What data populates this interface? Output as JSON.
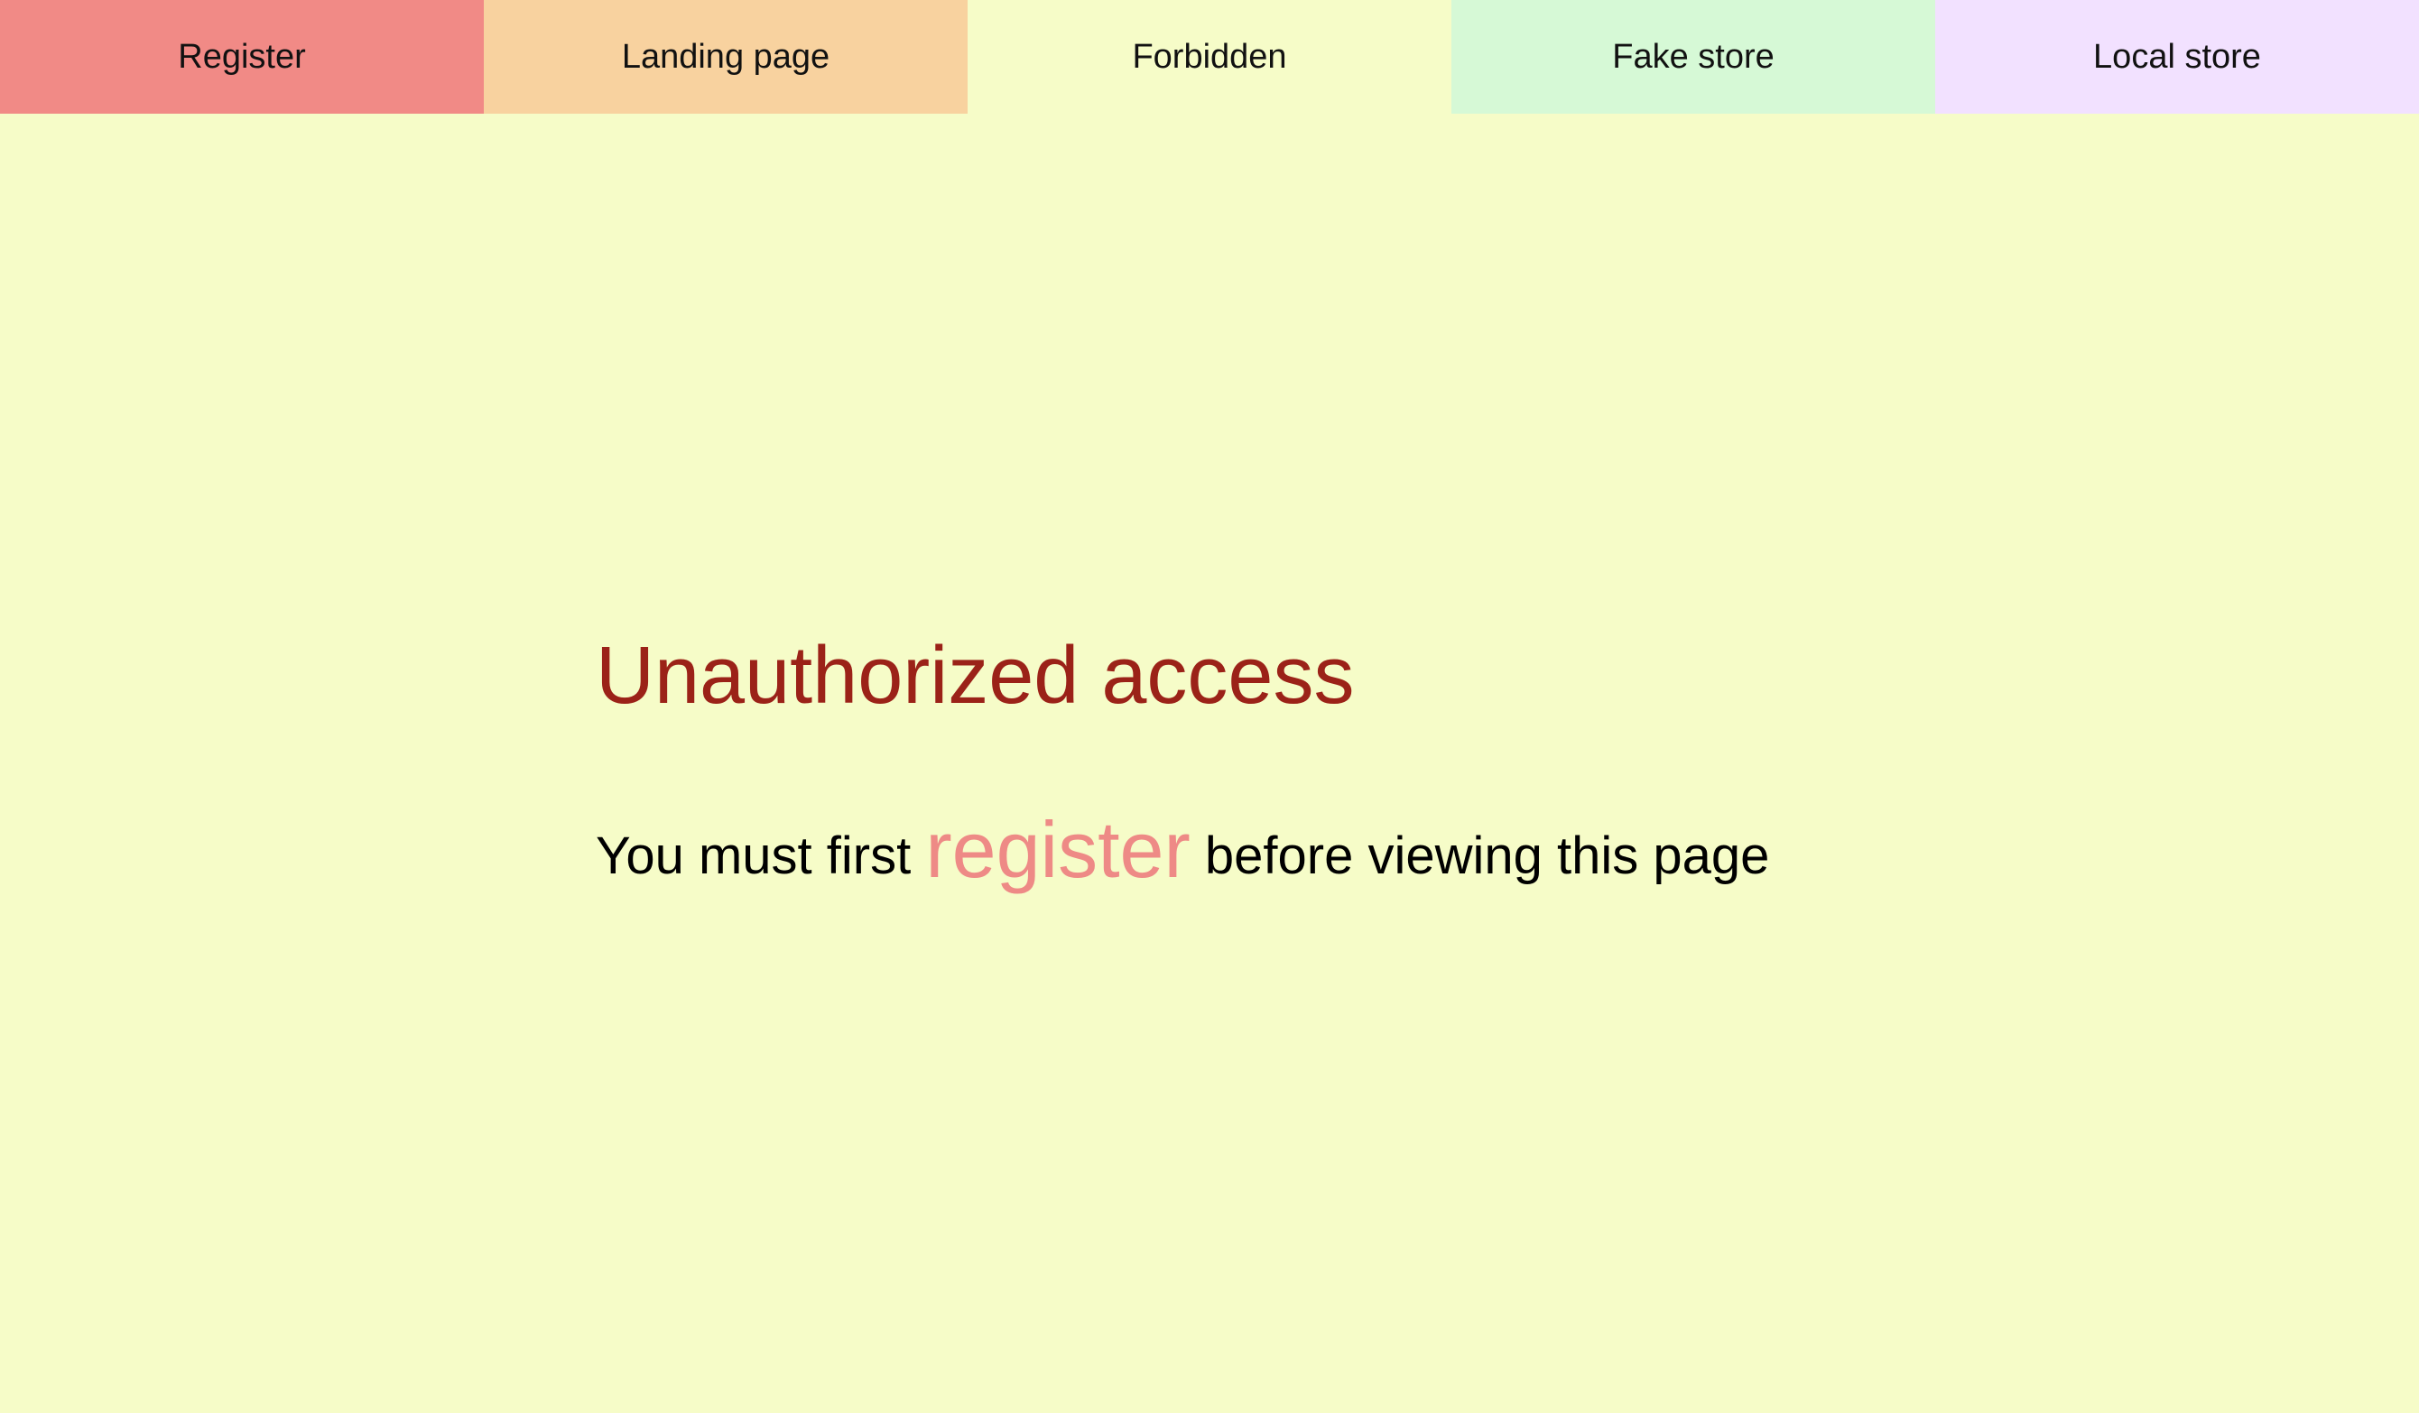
{
  "nav": {
    "tabs": [
      {
        "label": "Register",
        "color": "#f18a86"
      },
      {
        "label": "Landing page",
        "color": "#f8d29f"
      },
      {
        "label": "Forbidden",
        "color": "#f6fcc8",
        "active": true
      },
      {
        "label": "Fake store",
        "color": "#d6f9d6"
      },
      {
        "label": "Local store",
        "color": "#f2e1ff"
      }
    ]
  },
  "main": {
    "title": "Unauthorized access",
    "message_before": "You must first",
    "message_link": "register",
    "message_after": "before viewing this page"
  },
  "colors": {
    "background": "#f6fcc8",
    "title": "#9b2218",
    "link": "#ee8a86"
  }
}
